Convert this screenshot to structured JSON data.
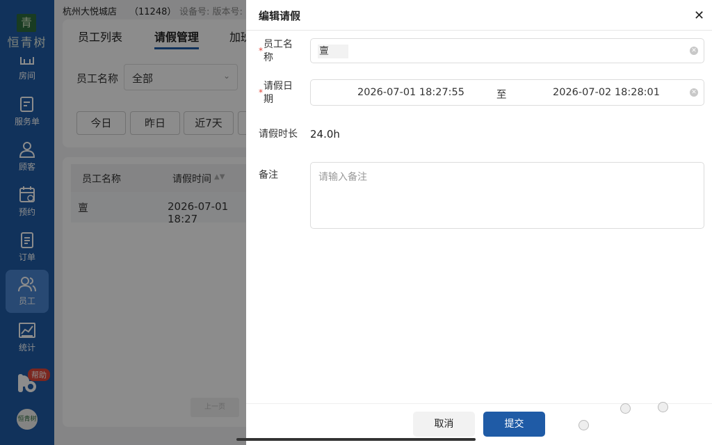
{
  "topbar": {
    "store": "杭州大悦城店",
    "store_id": "（11248）",
    "device": "设备号: 版本号:"
  },
  "brand": {
    "seal": "青",
    "name": "恒青树",
    "avatar": "恒青树"
  },
  "sidebar": {
    "items": [
      {
        "label": "房间",
        "icon": "room-icon"
      },
      {
        "label": "服务单",
        "icon": "service-order-icon"
      },
      {
        "label": "顾客",
        "icon": "customer-icon"
      },
      {
        "label": "预约",
        "icon": "calendar-icon"
      },
      {
        "label": "订单",
        "icon": "order-icon"
      },
      {
        "label": "员工",
        "icon": "staff-icon",
        "active": true
      },
      {
        "label": "统计",
        "icon": "chart-icon"
      }
    ],
    "help": "帮助"
  },
  "tabs": [
    {
      "label": "员工列表"
    },
    {
      "label": "请假管理",
      "active": true
    },
    {
      "label": "加班"
    }
  ],
  "filter": {
    "label": "员工名称",
    "value": "全部"
  },
  "date_buttons": [
    "今日",
    "昨日",
    "近7天"
  ],
  "table": {
    "headers": [
      "员工名称",
      "请假时间"
    ],
    "row": {
      "name": "亶",
      "time": "2026-07-01 18:27"
    }
  },
  "pager": {
    "prev": "上一页"
  },
  "drawer": {
    "title": "编辑请假",
    "employee": {
      "label": "员工名称",
      "value": "亶"
    },
    "date": {
      "label": "请假日期",
      "start": "2026-07-01 18:27:55",
      "separator": "至",
      "end": "2026-07-02 18:28:01"
    },
    "duration": {
      "label": "请假时长",
      "value": "24.0h"
    },
    "remark": {
      "label": "备注",
      "placeholder": "请输入备注"
    },
    "cancel": "取消",
    "submit": "提交"
  },
  "colors": {
    "primary": "#1f5ba6",
    "required": "#e0463a"
  }
}
